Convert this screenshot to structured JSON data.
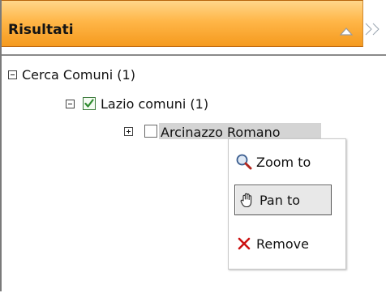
{
  "panel": {
    "title": "Risultati",
    "collapse_icon": "collapse-triangle-icon",
    "expand_icon": "double-chevron-right-icon"
  },
  "tree": {
    "root": {
      "label": "Cerca Comuni (1)",
      "expanded": true
    },
    "group": {
      "label": "Lazio comuni (1)",
      "expanded": true,
      "checked": true
    },
    "item": {
      "label": "Arcinazzo Romano",
      "expanded": false,
      "checked": false,
      "selected": true
    }
  },
  "context_menu": {
    "items": [
      {
        "label": "Zoom to",
        "icon": "magnifier-icon"
      },
      {
        "label": "Pan to",
        "icon": "hand-icon",
        "active": true
      },
      {
        "label": "Remove",
        "icon": "red-x-icon"
      }
    ]
  },
  "colors": {
    "header_top": "#ffd78a",
    "header_bottom": "#f59a1e",
    "selection": "#d4d4d4",
    "check_green": "#2e8b2e",
    "remove_red": "#cc1111"
  }
}
